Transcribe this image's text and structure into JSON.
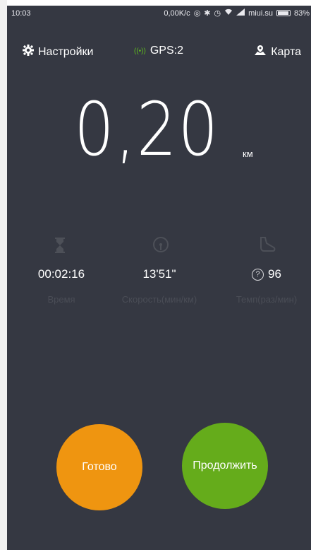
{
  "status_bar": {
    "time": "10:03",
    "network_speed": "0,00K/c",
    "carrier": "miui.su",
    "battery": "83%",
    "icons": [
      "sync-icon",
      "bluetooth-icon",
      "alarm-icon",
      "wifi-icon",
      "signal-icon",
      "battery-icon"
    ]
  },
  "header": {
    "settings_label": "Настройки",
    "gps_label": "GPS:2",
    "map_label": "Карта"
  },
  "distance": {
    "value": "0,20",
    "unit": "км"
  },
  "stats": [
    {
      "icon": "hourglass-icon",
      "value": "00:02:16",
      "label": "Время"
    },
    {
      "icon": "speedometer-icon",
      "value": "13'51\"",
      "label": "Скорость(мин/км)"
    },
    {
      "icon": "shoe-icon",
      "value": "96",
      "label": "Темп(раз/мин)"
    }
  ],
  "buttons": {
    "done": "Готово",
    "continue": "Продолжить"
  },
  "colors": {
    "background": "#353842",
    "done_button": "#ef9510",
    "continue_button": "#65ac1b",
    "gps_indicator": "#5fbb1e"
  }
}
